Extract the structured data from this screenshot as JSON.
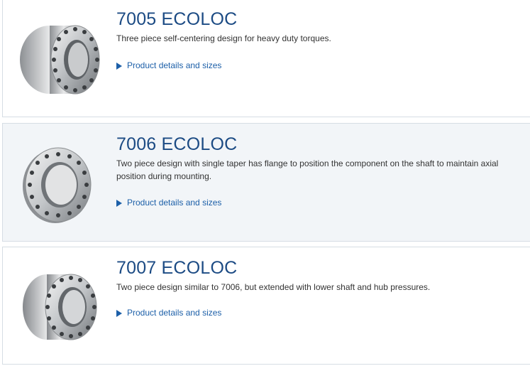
{
  "products": [
    {
      "title": "7005 ECOLOC",
      "description": "Three piece self-centering design for heavy duty torques.",
      "link_label": "Product details and sizes",
      "image": "locking-assembly-three-piece-icon"
    },
    {
      "title": "7006 ECOLOC",
      "description": "Two piece design with single taper has flange to position the component on the shaft to maintain axial position during mounting.",
      "link_label": "Product details and sizes",
      "image": "locking-assembly-flanged-icon"
    },
    {
      "title": "7007 ECOLOC",
      "description": "Two piece design similar to 7006, but extended with lower shaft and hub pressures.",
      "link_label": "Product details and sizes",
      "image": "locking-assembly-extended-icon"
    }
  ],
  "colors": {
    "title": "#1c4b84",
    "link": "#1c5fa8",
    "card_alt_bg": "#f2f5f8",
    "border": "#d6dde4"
  }
}
